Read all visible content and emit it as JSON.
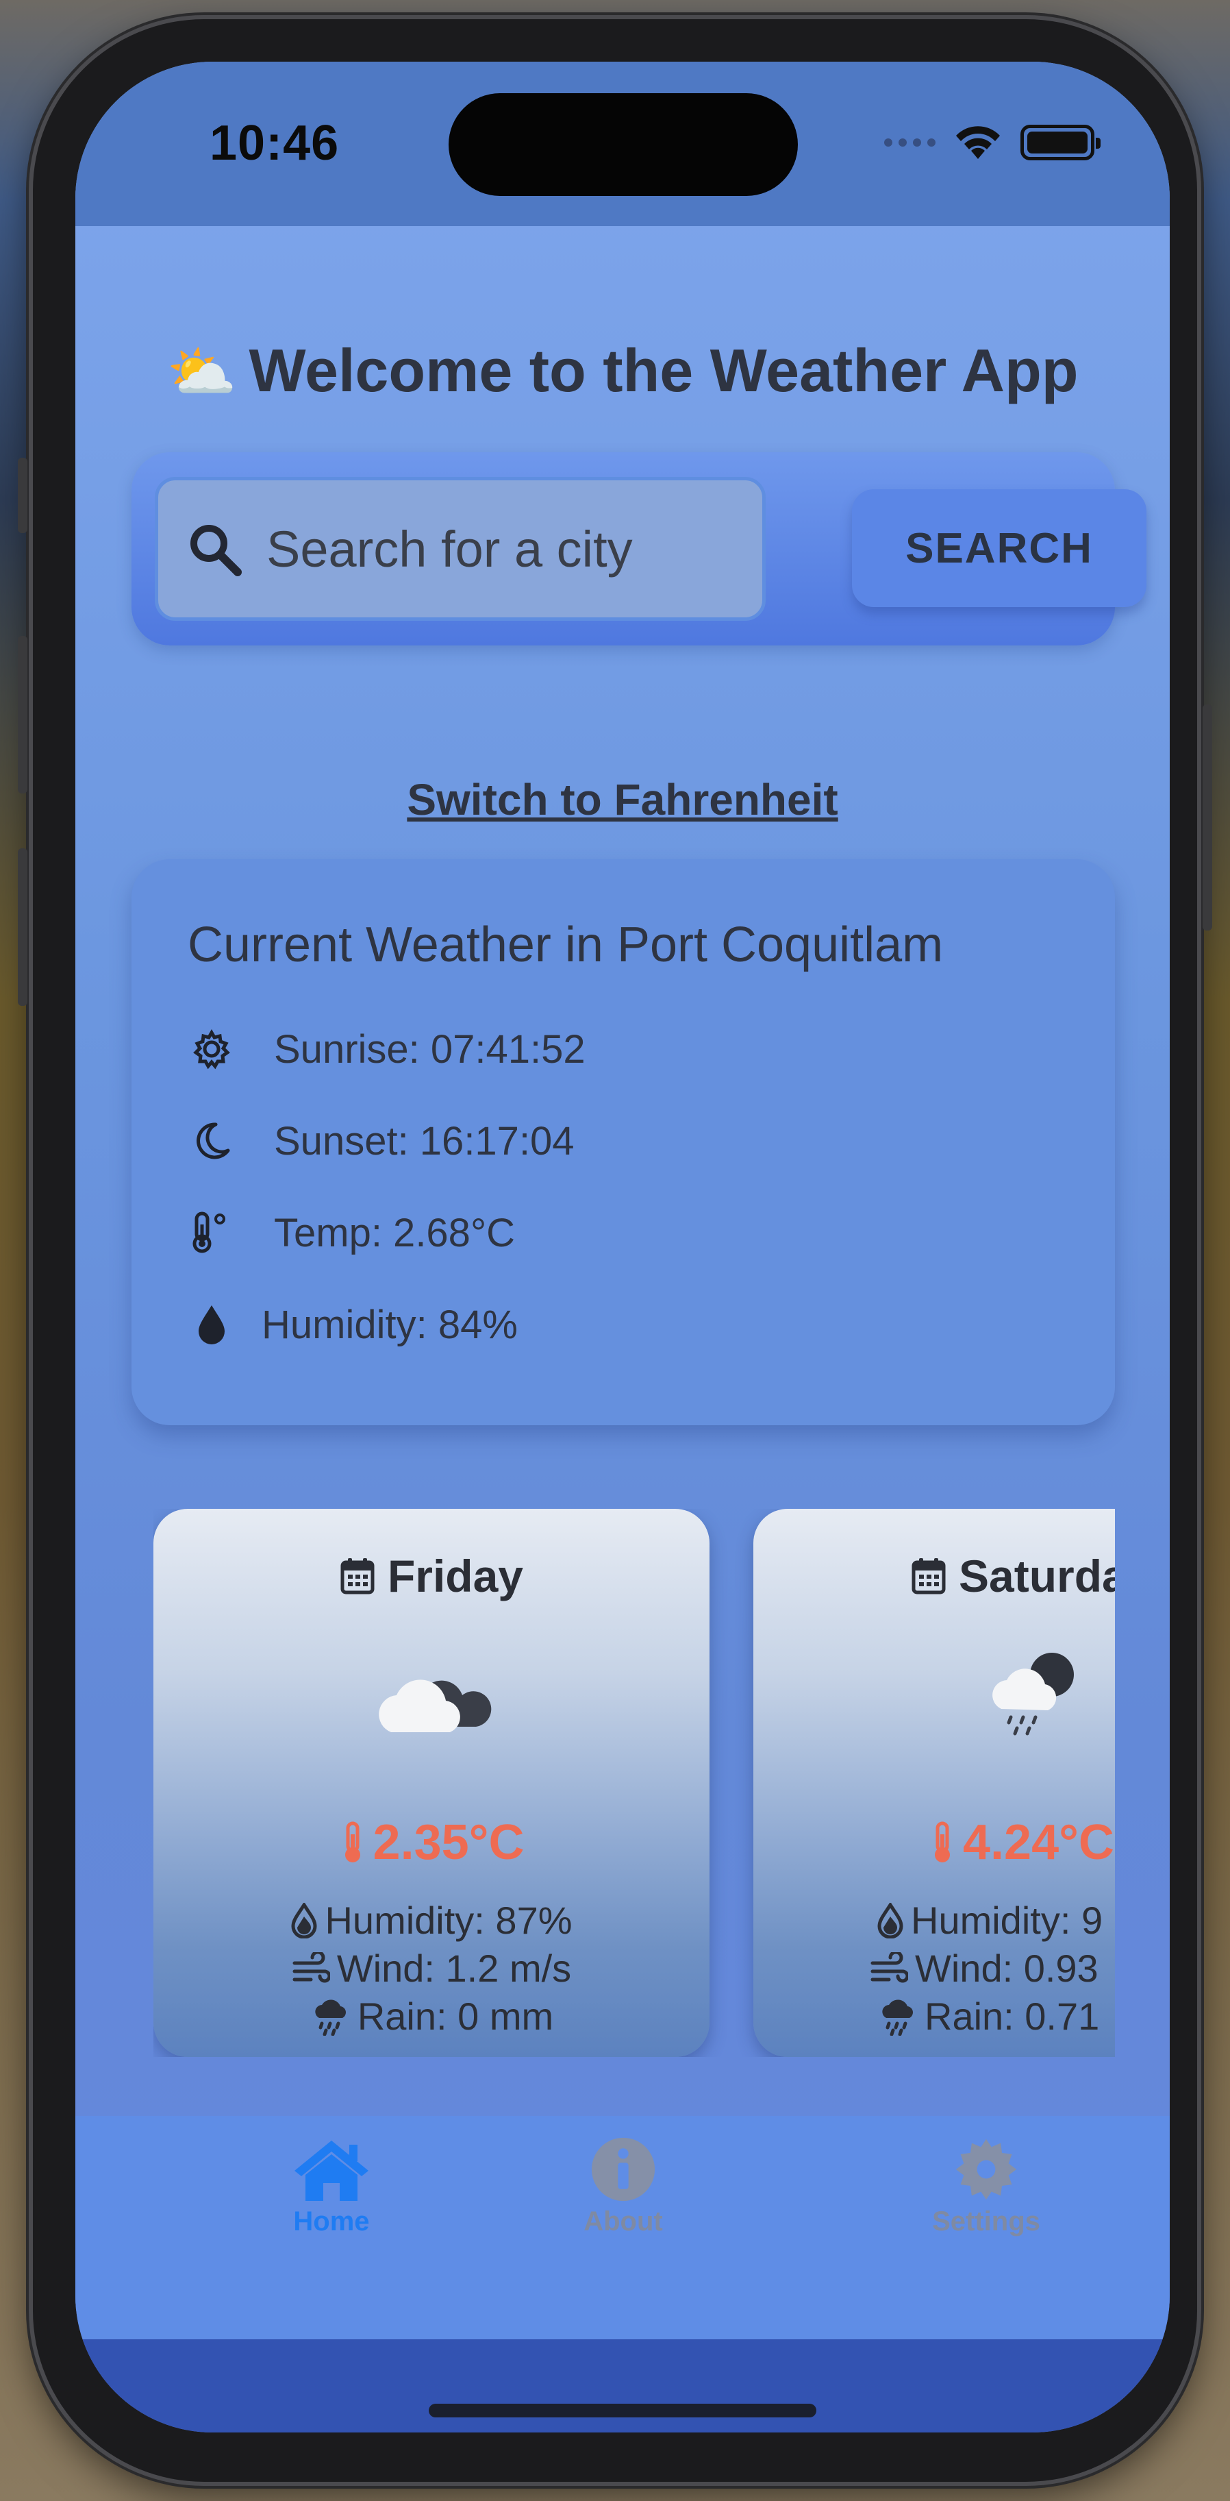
{
  "status_bar": {
    "time": "10:46"
  },
  "header": {
    "emoji": "⛅",
    "title": "Welcome to the Weather App"
  },
  "search": {
    "placeholder": "Search for a city",
    "button_label": "SEARCH"
  },
  "unit_toggle": {
    "label": "Switch to Fahrenheit"
  },
  "current_weather": {
    "heading": "Current Weather in Port Coquitlam",
    "sunrise": "Sunrise: 07:41:52",
    "sunset": "Sunset: 16:17:04",
    "temp": "Temp: 2.68°C",
    "humidity": "Humidity: 84%"
  },
  "forecast": [
    {
      "day": "Friday",
      "icon": "cloudy-icon",
      "temp": "2.35°C",
      "humidity": "Humidity: 87%",
      "wind": "Wind: 1.2 m/s",
      "rain": "Rain: 0 mm"
    },
    {
      "day": "Saturda",
      "icon": "rain-night-icon",
      "temp": "4.24°C",
      "humidity": "Humidity: 9",
      "wind": "Wind: 0.93",
      "rain": "Rain: 0.71"
    }
  ],
  "tabs": [
    {
      "label": "Home",
      "icon": "home-icon",
      "active": true
    },
    {
      "label": "About",
      "icon": "info-icon",
      "active": false
    },
    {
      "label": "Settings",
      "icon": "gear-icon",
      "active": false
    }
  ],
  "colors": {
    "accent": "#1f7cf2",
    "temp": "#ee6b52",
    "inactive_tab": "#7f8aa3",
    "text": "#2e3442"
  }
}
